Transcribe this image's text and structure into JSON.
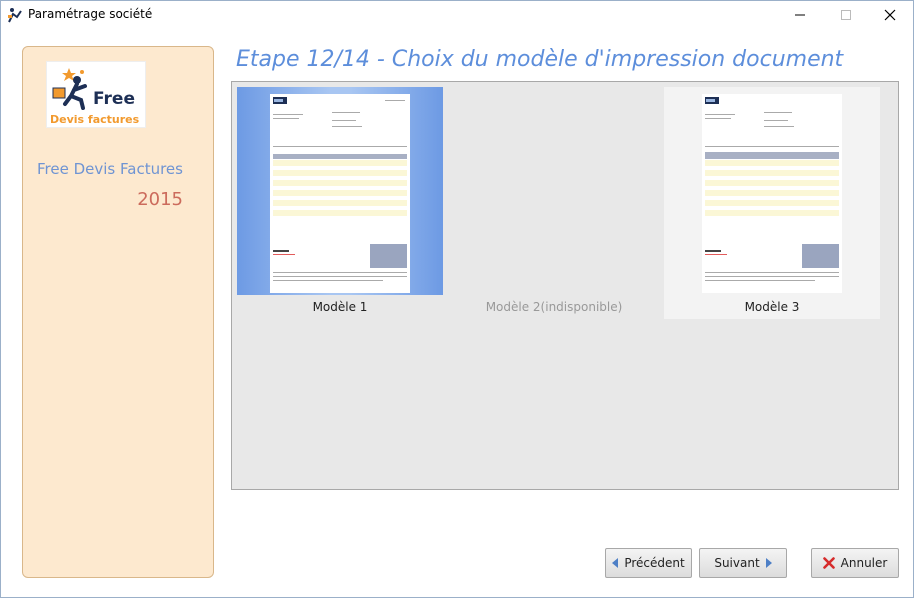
{
  "window": {
    "title": "Paramétrage société"
  },
  "sidebar": {
    "logo_text_top": "Free",
    "logo_text_bottom": "Devis factures",
    "app_name": "Free Devis Factures",
    "app_year": "2015"
  },
  "step": {
    "title": "Etape 12/14 - Choix du modèle d'impression document"
  },
  "models": [
    {
      "label": "Modèle 1",
      "state": "selected"
    },
    {
      "label": "Modèle 2(indisponible)",
      "state": "disabled"
    },
    {
      "label": "Modèle 3",
      "state": "available"
    }
  ],
  "buttons": {
    "previous": "Précédent",
    "next": "Suivant",
    "cancel": "Annuler"
  },
  "colors": {
    "accent": "#5d8edb",
    "sidebar_bg": "#fde9cf",
    "year": "#cc6b5c",
    "cancel_icon": "#d62b2b"
  }
}
